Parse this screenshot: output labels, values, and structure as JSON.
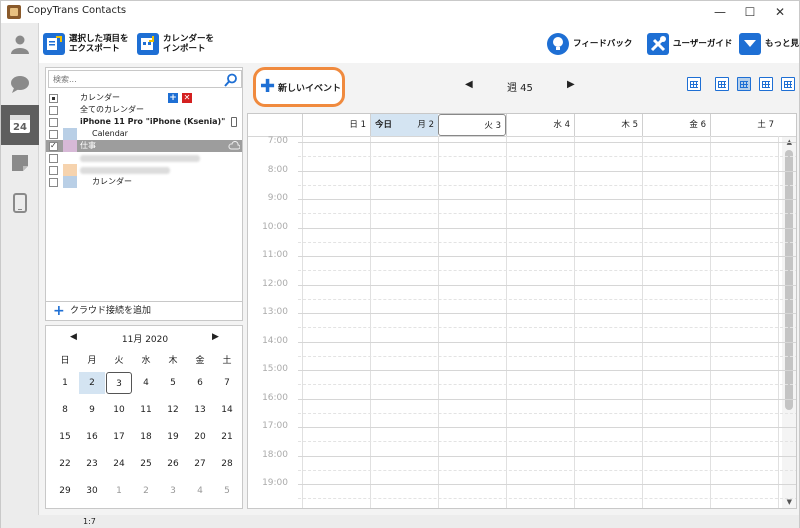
{
  "window": {
    "title": "CopyTrans Contacts",
    "controls": [
      "—",
      "☐",
      "✕"
    ]
  },
  "sidenav": [
    {
      "icon": "contacts-icon",
      "glyph": "👤"
    },
    {
      "icon": "messages-icon",
      "glyph": "💬"
    },
    {
      "icon": "calendar-icon",
      "glyph": "24",
      "active": true
    },
    {
      "icon": "notes-icon",
      "glyph": "▰"
    },
    {
      "icon": "device-icon",
      "glyph": "▯"
    }
  ],
  "toolbar": {
    "export_label": "選択した項目を\nエクスポート",
    "import_label": "カレンダーを\nインポート",
    "feedback_label": "フィードバック",
    "guide_label": "ユーザーガイド",
    "more_label": "もっと見る"
  },
  "search": {
    "placeholder": "検索..."
  },
  "calendars": {
    "header": "カレンダー",
    "all": "全てのカレンダー",
    "device": "iPhone 11 Pro \"iPhone (Ksenia)\"",
    "calendar": "Calendar",
    "work": "仕事",
    "last": "カレンダー",
    "colors": {
      "calendar": "#b9cfe6",
      "work": "#d7b9d7",
      "blur1": "#f6d3ae",
      "last": "#b9cfe6"
    }
  },
  "add_cloud": "クラウド接続を追加",
  "minical": {
    "month": "11月 2020",
    "weekdays": [
      "日",
      "月",
      "火",
      "水",
      "木",
      "金",
      "土"
    ],
    "weeks": [
      [
        "1",
        "2",
        "3",
        "4",
        "5",
        "6",
        "7"
      ],
      [
        "8",
        "9",
        "10",
        "11",
        "12",
        "13",
        "14"
      ],
      [
        "15",
        "16",
        "17",
        "18",
        "19",
        "20",
        "21"
      ],
      [
        "22",
        "23",
        "24",
        "25",
        "26",
        "27",
        "28"
      ],
      [
        "29",
        "30",
        "1",
        "2",
        "3",
        "4",
        "5"
      ]
    ],
    "selected": "2",
    "today": "3"
  },
  "new_event": "新しいイベント",
  "week_label": "週 45",
  "days": [
    {
      "label": "日 1"
    },
    {
      "label": "月 2",
      "today_text": "今日"
    },
    {
      "label": "火 3"
    },
    {
      "label": "水 4"
    },
    {
      "label": "木 5"
    },
    {
      "label": "金 6"
    },
    {
      "label": "土 7"
    }
  ],
  "hours": [
    "7:00",
    "8:00",
    "9:00",
    "10:00",
    "11:00",
    "12:00",
    "13:00",
    "14:00",
    "15:00",
    "16:00",
    "17:00",
    "18:00",
    "19:00"
  ],
  "status": "1:7"
}
